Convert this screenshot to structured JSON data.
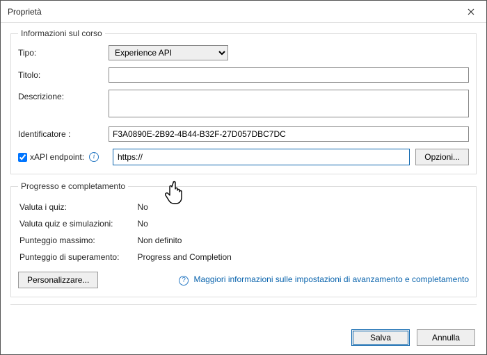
{
  "window": {
    "title": "Proprietà"
  },
  "group_info": {
    "legend": "Informazioni sul corso",
    "type_label": "Tipo:",
    "type_value": "Experience API",
    "title_label": "Titolo:",
    "title_value": "",
    "description_label": "Descrizione:",
    "description_value": "",
    "identifier_label": "Identificatore :",
    "identifier_value": "F3A0890E-2B92-4B44-B32F-27D057DBC7DC",
    "xapi_label": "xAPI endpoint:",
    "xapi_value": "https://",
    "options_button": "Opzioni..."
  },
  "group_progress": {
    "legend": "Progresso e completamento",
    "eval_quiz_label": "Valuta i quiz:",
    "eval_quiz_value": "No",
    "eval_quizsim_label": "Valuta quiz e simulazioni:",
    "eval_quizsim_value": "No",
    "max_score_label": "Punteggio massimo:",
    "max_score_value": "Non definito",
    "pass_score_label": "Punteggio di superamento:",
    "pass_score_value": "Progress and Completion",
    "customize_button": "Personalizzare...",
    "info_link": "Maggiori informazioni sulle impostazioni di avanzamento e completamento"
  },
  "footer": {
    "save": "Salva",
    "cancel": "Annulla"
  }
}
